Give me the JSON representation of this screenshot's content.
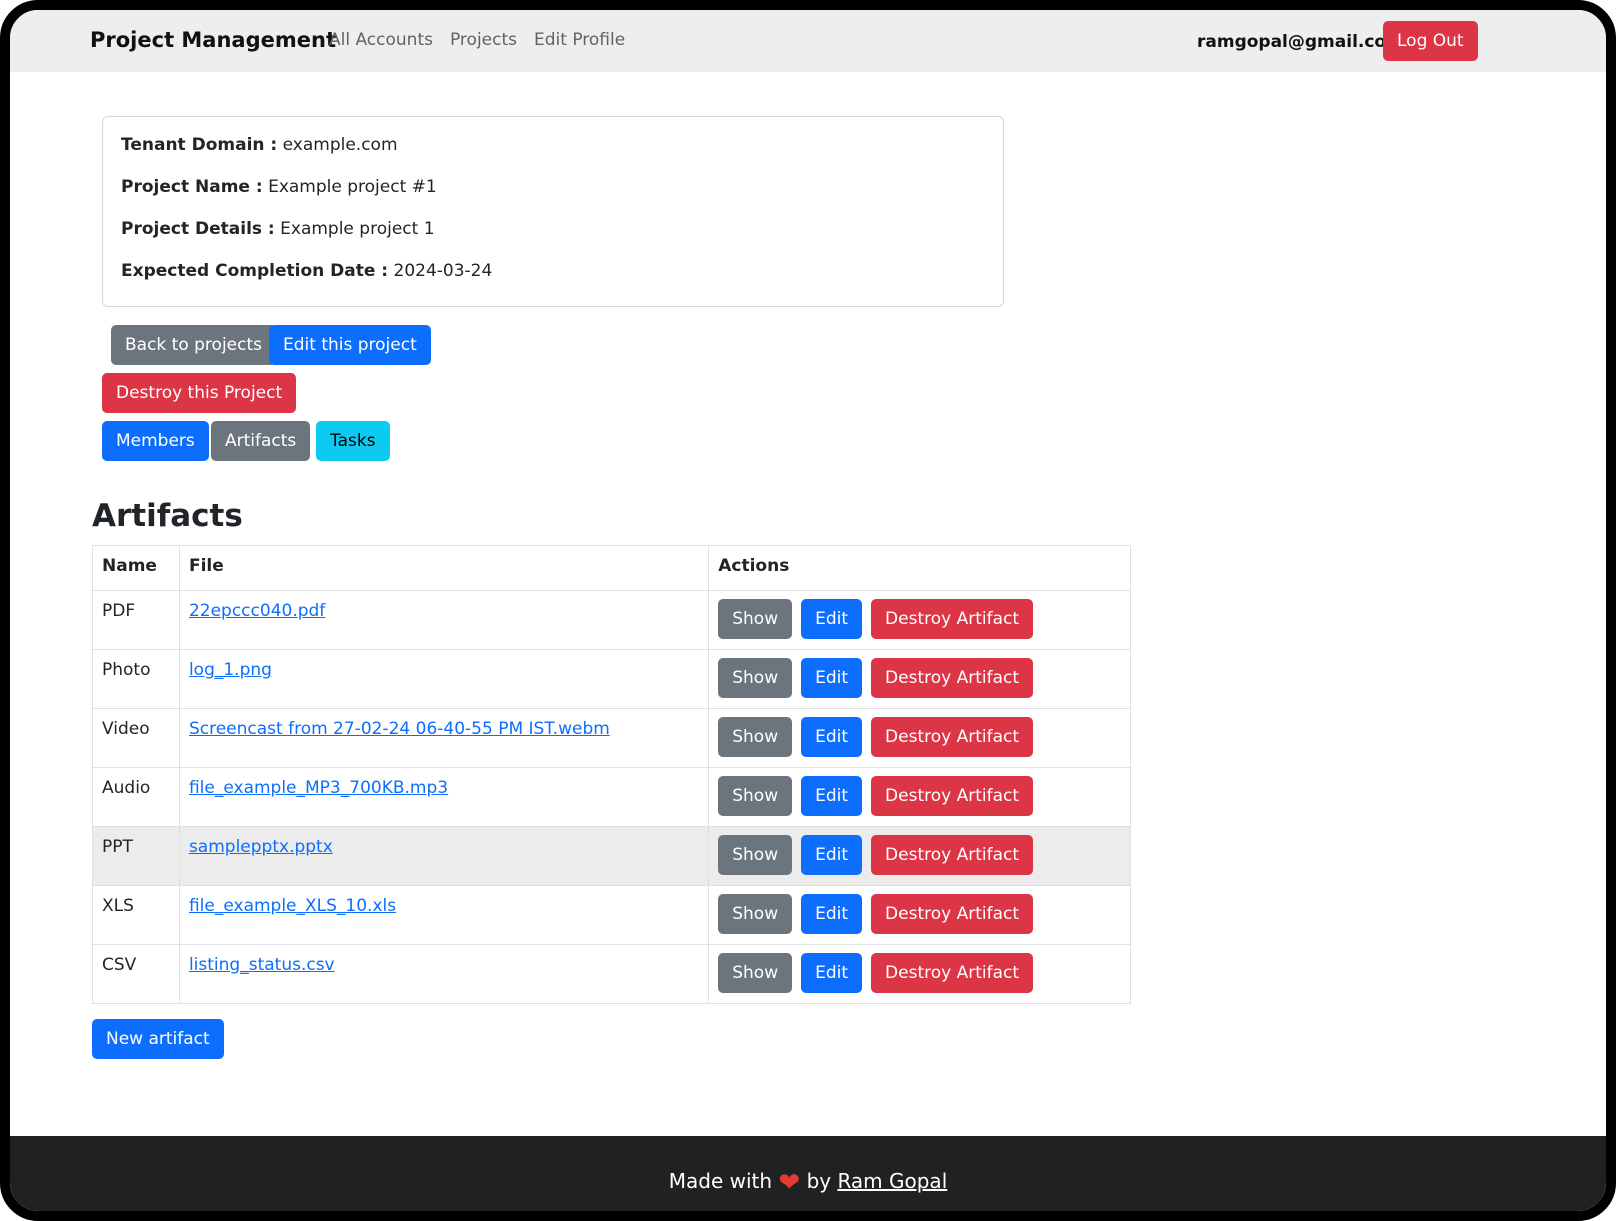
{
  "navbar": {
    "brand": "Project Management",
    "links": [
      "All Accounts",
      "Projects",
      "Edit Profile"
    ],
    "user_email": "ramgopal@gmail.com",
    "logout_label": "Log Out"
  },
  "project": {
    "tenant_domain_label": "Tenant Domain :",
    "tenant_domain": "example.com",
    "name_label": "Project Name :",
    "name": "Example project #1",
    "details_label": "Project Details :",
    "details": "Example project 1",
    "completion_label": "Expected Completion Date :",
    "completion_date": "2024-03-24"
  },
  "buttons": {
    "back": "Back to projects",
    "edit": "Edit this project",
    "destroy": "Destroy this Project",
    "members": "Members",
    "artifacts": "Artifacts",
    "tasks": "Tasks"
  },
  "artifacts": {
    "heading": "Artifacts",
    "columns": [
      "Name",
      "File",
      "Actions"
    ],
    "action_labels": {
      "show": "Show",
      "edit": "Edit",
      "destroy": "Destroy Artifact"
    },
    "rows": [
      {
        "name": "PDF",
        "file": "22epccc040.pdf"
      },
      {
        "name": "Photo",
        "file": "log_1.png"
      },
      {
        "name": "Video",
        "file": "Screencast from 27-02-24 06-40-55 PM IST.webm"
      },
      {
        "name": "Audio",
        "file": "file_example_MP3_700KB.mp3"
      },
      {
        "name": "PPT",
        "file": "samplepptx.pptx"
      },
      {
        "name": "XLS",
        "file": "file_example_XLS_10.xls"
      },
      {
        "name": "CSV",
        "file": "listing_status.csv"
      }
    ],
    "new_label": "New artifact"
  },
  "footer": {
    "made_with": "Made with",
    "heart": "❤",
    "by": "by",
    "author": "Ram Gopal"
  },
  "colors": {
    "primary": "#0d6efd",
    "secondary": "#6c757d",
    "danger": "#dc3545",
    "info": "#0dcaf0",
    "navbar_bg": "#eeeeee",
    "footer_bg": "#212121"
  }
}
